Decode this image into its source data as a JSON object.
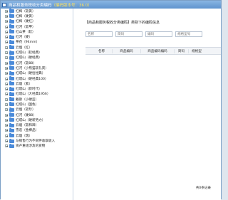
{
  "window": {
    "title": "商品和服务税收分类编码",
    "title_hint": "（编码版本号：36.0）"
  },
  "tree": {
    "items": [
      "红梅（软黄）",
      "红梅（硬黄）",
      "红梅（硬红）",
      "红河（软甲）",
      "红山茶（软）",
      "红河（硬）",
      "茶花（94mm）",
      "云烟（红）",
      "红塔山（软经典）",
      "红塔山（硬经典）",
      "红河（软88）",
      "红河（小熊猫软礼宾）",
      "红塔山（硬恒经典）",
      "红塔山（硬经典100）",
      "云烟（紫）",
      "红塔山（新时代）",
      "红塔山（大经典1956）",
      "戴斯（小硬蓝）",
      "红塔山（国色）",
      "云烟（软珍）",
      "红河（硬88）",
      "红塔山（硬新势力）",
      "云烟（软和蹄）",
      "雪莲（金樽品）",
      "云烟（瑞）",
      "与销售行为不同伴收取收入",
      "资产重组涉及的货物"
    ]
  },
  "content": {
    "breadcrumb_tag": "【商品和服务税收分类编码】",
    "breadcrumb_rest": "类别下的编码信息",
    "filters": {
      "name_placeholder": "名称",
      "shortcode_placeholder": "简码",
      "code_placeholder": "编码",
      "model_placeholder": "规格型号"
    },
    "columns": [
      "",
      "名称",
      "商品编码",
      "商品编码编码",
      "简码",
      "规格型"
    ],
    "footer": "共0条记录"
  }
}
